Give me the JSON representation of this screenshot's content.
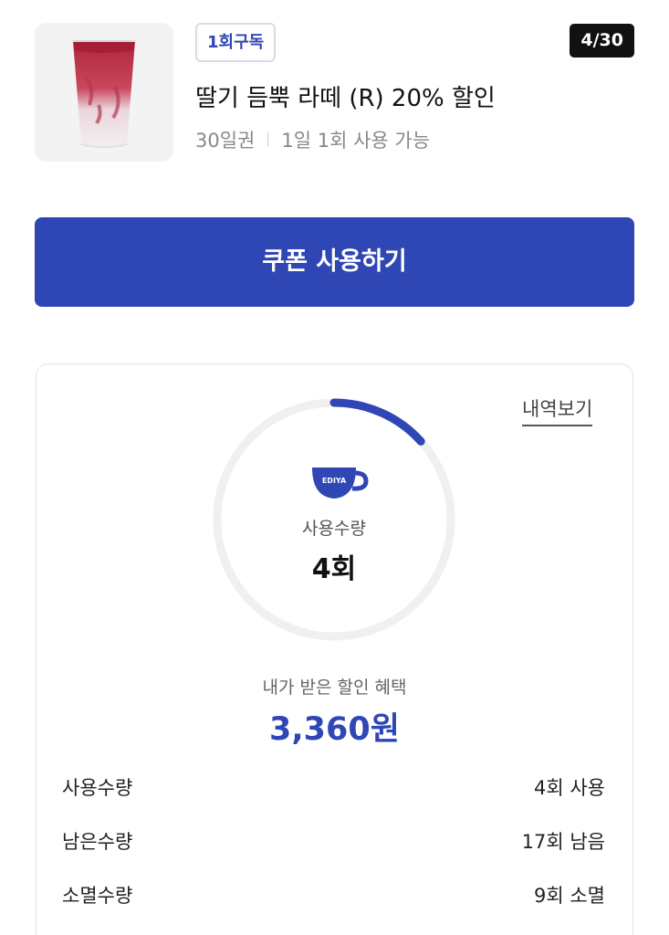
{
  "product": {
    "badge": "1회구독",
    "counter": "4/30",
    "title": "딸기 듬뿍 라떼 (R) 20% 할인",
    "period": "30일권",
    "rule": "1일 1회 사용 가능",
    "image_icon": "strawberry-latte-cup"
  },
  "actions": {
    "use_coupon": "쿠폰 사용하기"
  },
  "summary": {
    "history_link": "내역보기",
    "brand_mark": "EDIYA",
    "usage_label": "사용수량",
    "usage_value": "4회",
    "usage_progress": {
      "used": 4,
      "total": 30
    },
    "benefit_label": "내가 받은 할인 혜택",
    "benefit_value": "3,360원"
  },
  "stats": [
    {
      "label": "사용수량",
      "value": "4회 사용"
    },
    {
      "label": "남은수량",
      "value": "17회 남음"
    },
    {
      "label": "소멸수량",
      "value": "9회 소멸"
    }
  ],
  "colors": {
    "accent": "#2f46b5",
    "ring_track": "#f0f0f0",
    "counter_bg": "#111111"
  }
}
